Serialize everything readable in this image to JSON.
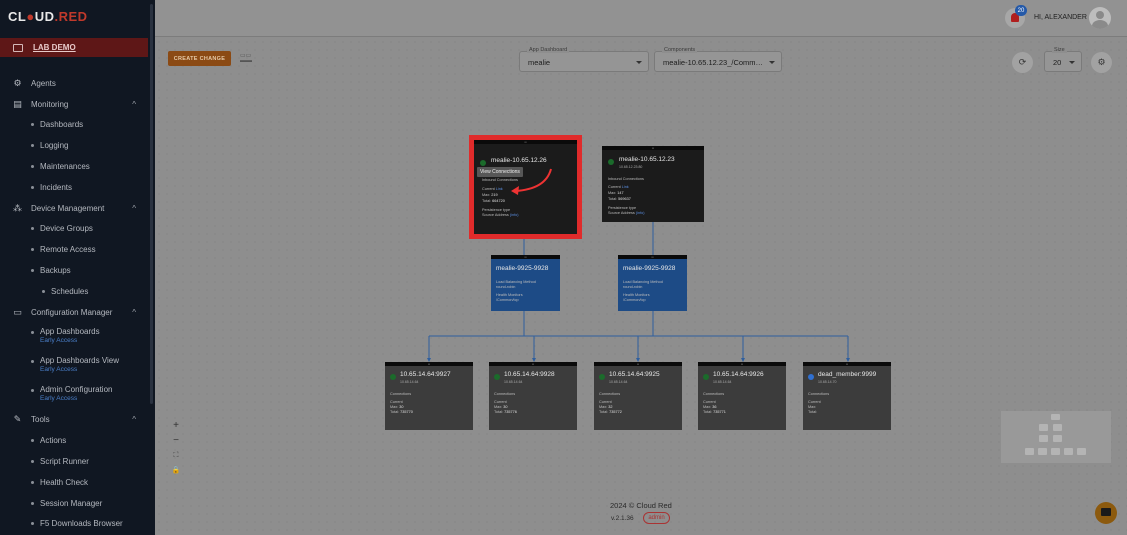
{
  "brand": {
    "name_a": "CL",
    "name_b": "UD",
    "name_c": ".RED"
  },
  "sidebar": {
    "active": "LAB DEMO",
    "items": [
      {
        "kind": "section",
        "icon": "agents-icon",
        "label": "Agents"
      },
      {
        "kind": "section",
        "icon": "monitoring-icon",
        "label": "Monitoring",
        "expanded": true
      },
      {
        "kind": "sub",
        "label": "Dashboards"
      },
      {
        "kind": "sub",
        "label": "Logging"
      },
      {
        "kind": "sub",
        "label": "Maintenances"
      },
      {
        "kind": "sub",
        "label": "Incidents"
      },
      {
        "kind": "section",
        "icon": "device-management-icon",
        "label": "Device Management",
        "expanded": true
      },
      {
        "kind": "sub",
        "label": "Device Groups"
      },
      {
        "kind": "sub",
        "label": "Remote Access"
      },
      {
        "kind": "sub",
        "label": "Backups"
      },
      {
        "kind": "sub2",
        "label": "Schedules"
      },
      {
        "kind": "section",
        "icon": "configuration-manager-icon",
        "label": "Configuration Manager",
        "expanded": true
      },
      {
        "kind": "tall",
        "label": "App Dashboards",
        "early": "Early Access"
      },
      {
        "kind": "tall",
        "label": "App Dashboards View",
        "early": "Early Access"
      },
      {
        "kind": "tall",
        "label": "Admin Configuration",
        "early": "Early Access"
      },
      {
        "kind": "section",
        "icon": "tools-icon",
        "label": "Tools",
        "expanded": true
      },
      {
        "kind": "sub",
        "label": "Actions"
      },
      {
        "kind": "sub",
        "label": "Script Runner"
      },
      {
        "kind": "sub",
        "label": "Health Check"
      },
      {
        "kind": "sub",
        "label": "Session Manager"
      },
      {
        "kind": "sub",
        "label": "F5 Downloads Browser"
      }
    ]
  },
  "header": {
    "notifications": "20",
    "greeting": "HI, ALEXANDER"
  },
  "toolbar": {
    "create_change": "CREATE CHANGE",
    "app_dashboard_label": "App Dashboard",
    "app_dashboard_value": "mealie",
    "components_label": "Components",
    "components_value": "mealie-10.65.12.23_/Comm…",
    "size_label": "Size",
    "size_value": "20"
  },
  "tooltip": "View Connections",
  "nodes": {
    "vs1": {
      "title": "mealie-10.65.12.26",
      "inbound": "Inbound Connections",
      "current": "Current",
      "current_link": "Link",
      "max_label": "Max:",
      "max_value": "219",
      "total_label": "Total:",
      "total_value": "664720",
      "persistence": "Persistence type",
      "source": "Source Address",
      "source_link": "(info)"
    },
    "vs2": {
      "title": "mealie-10.65.12.23",
      "subtitle": "10.65.12.23:80",
      "inbound": "Inbound Connections",
      "current": "Current",
      "current_link": "Link",
      "max_label": "Max:",
      "max_value": "147",
      "total_label": "Total:",
      "total_value": "569637",
      "persistence": "Persistence type",
      "source": "Source Address",
      "source_link": "(info)"
    },
    "pool1": {
      "title": "mealie-9925-9928",
      "lb": "Load Balancing Method",
      "lb_value": "round-robin",
      "hm": "Health Monitors",
      "hm_value": "/Common/tcp"
    },
    "pool2": {
      "title": "mealie-9925-9928",
      "lb": "Load Balancing Method",
      "lb_value": "round-robin",
      "hm": "Health Monitors",
      "hm_value": "/Common/tcp"
    },
    "members": [
      {
        "title": "10.65.14.64:9927",
        "sub": "10.65.14.64",
        "conn": "Connections",
        "current": "Current",
        "max": "Max:",
        "max_v": "30",
        "total": "Total:",
        "total_v": "735770",
        "status": "green"
      },
      {
        "title": "10.65.14.64:9928",
        "sub": "10.65.14.64",
        "conn": "Connections",
        "current": "Current",
        "max": "Max:",
        "max_v": "30",
        "total": "Total:",
        "total_v": "735776",
        "status": "green"
      },
      {
        "title": "10.65.14.64:9925",
        "sub": "10.65.14.64",
        "conn": "Connections",
        "current": "Current",
        "max": "Max:",
        "max_v": "32",
        "total": "Total:",
        "total_v": "735772",
        "status": "green"
      },
      {
        "title": "10.65.14.64:9926",
        "sub": "10.65.14.64",
        "conn": "Connections",
        "current": "Current",
        "max": "Max:",
        "max_v": "36",
        "total": "Total:",
        "total_v": "735771",
        "status": "green"
      },
      {
        "title": "dead_member:9999",
        "sub": "10.65.14.70",
        "conn": "Connections",
        "current": "Current",
        "max": "Max:",
        "max_v": "",
        "total": "Total:",
        "total_v": "",
        "status": "blue"
      }
    ]
  },
  "zoom": {
    "in": "+",
    "out": "−",
    "fit": "⛶",
    "lock": "🔒"
  },
  "footer": {
    "copyright": "2024 © Cloud Red",
    "version": "v.2.1.36",
    "role": "admin"
  },
  "colors": {
    "sidebar_bg": "#101722",
    "accent_red": "#e02b2b",
    "pool_blue": "#1d4b86",
    "create_btn": "#8b4a14"
  }
}
